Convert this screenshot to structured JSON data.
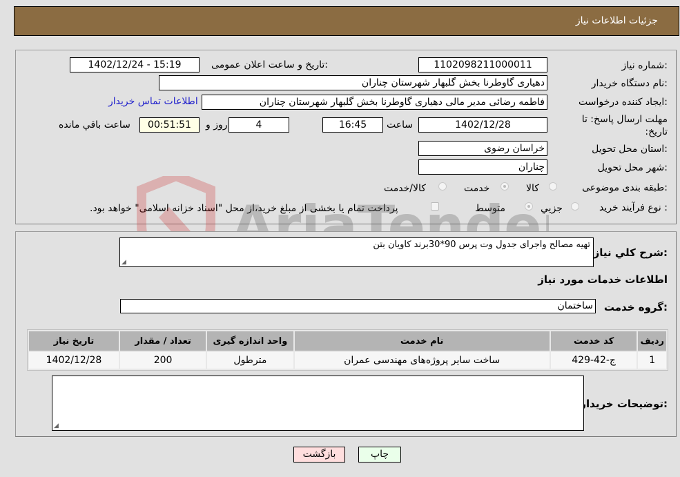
{
  "header": {
    "title": "جزئیات اطلاعات نیاز"
  },
  "details": {
    "need_number_label": "شماره نیاز:",
    "need_number": "1102098211000011",
    "announce_label": "تاریخ و ساعت اعلان عمومی:",
    "announce_value": "1402/12/24 - 15:19",
    "buyer_org_label": "نام دستگاه خریدار:",
    "buyer_org": "دهیاری گاوطرنا بخش گلبهار شهرستان چناران",
    "creator_label": "ایجاد کننده درخواست:",
    "creator": "فاطمه رضائی مدیر مالی دهیاری گاوطرنا بخش گلبهار شهرستان چناران",
    "contact_link": "اطلاعات تماس خریدار",
    "deadline_label": "مهلت ارسال پاسخ: تا تاریخ:",
    "deadline_date": "1402/12/28",
    "time_label": "ساعت",
    "deadline_time": "16:45",
    "days_value": "4",
    "days_label": "روز و",
    "remaining_time": "00:51:51",
    "remaining_label": "ساعت باقي مانده",
    "province_label": "استان محل تحویل:",
    "province": "خراسان رضوی",
    "city_label": "شهر محل تحویل:",
    "city": "چناران",
    "category_label": "طبقه بندی موضوعی:",
    "category_options": [
      "کالا",
      "خدمت",
      "کالا/خدمت"
    ],
    "category_selected": "خدمت",
    "process_label": "نوع فرآیند خرید :",
    "process_options": [
      "جزيي",
      "متوسط"
    ],
    "process_selected": "متوسط",
    "treasury_note": "پرداخت تمام یا بخشی از مبلغ خرید،از محل \"اسناد خزانه اسلامی\" خواهد بود."
  },
  "description": {
    "label": "شرح كلي نياز:",
    "value": "تهیه مصالح واجرای جدول وت پرس 90*30برند کاویان بتن"
  },
  "services": {
    "section_title": "اطلاعات خدمات مورد نیاز",
    "group_label": "گروه خدمت:",
    "group_value": "ساختمان",
    "table": {
      "headers": [
        "ردیف",
        "کد خدمت",
        "نام خدمت",
        "واحد اندازه گیری",
        "تعداد / مقدار",
        "تاریخ نیاز"
      ],
      "rows": [
        [
          "1",
          "ج-42-429",
          "ساخت سایر پروژه‌های مهندسی عمران",
          "مترطول",
          "200",
          "1402/12/28"
        ]
      ]
    }
  },
  "buyer_notes": {
    "label": "توضیحات خریدار:",
    "value": ""
  },
  "buttons": {
    "print": "چاپ",
    "back": "بازگشت"
  },
  "watermark": {
    "text": "AriaTender.neT"
  }
}
